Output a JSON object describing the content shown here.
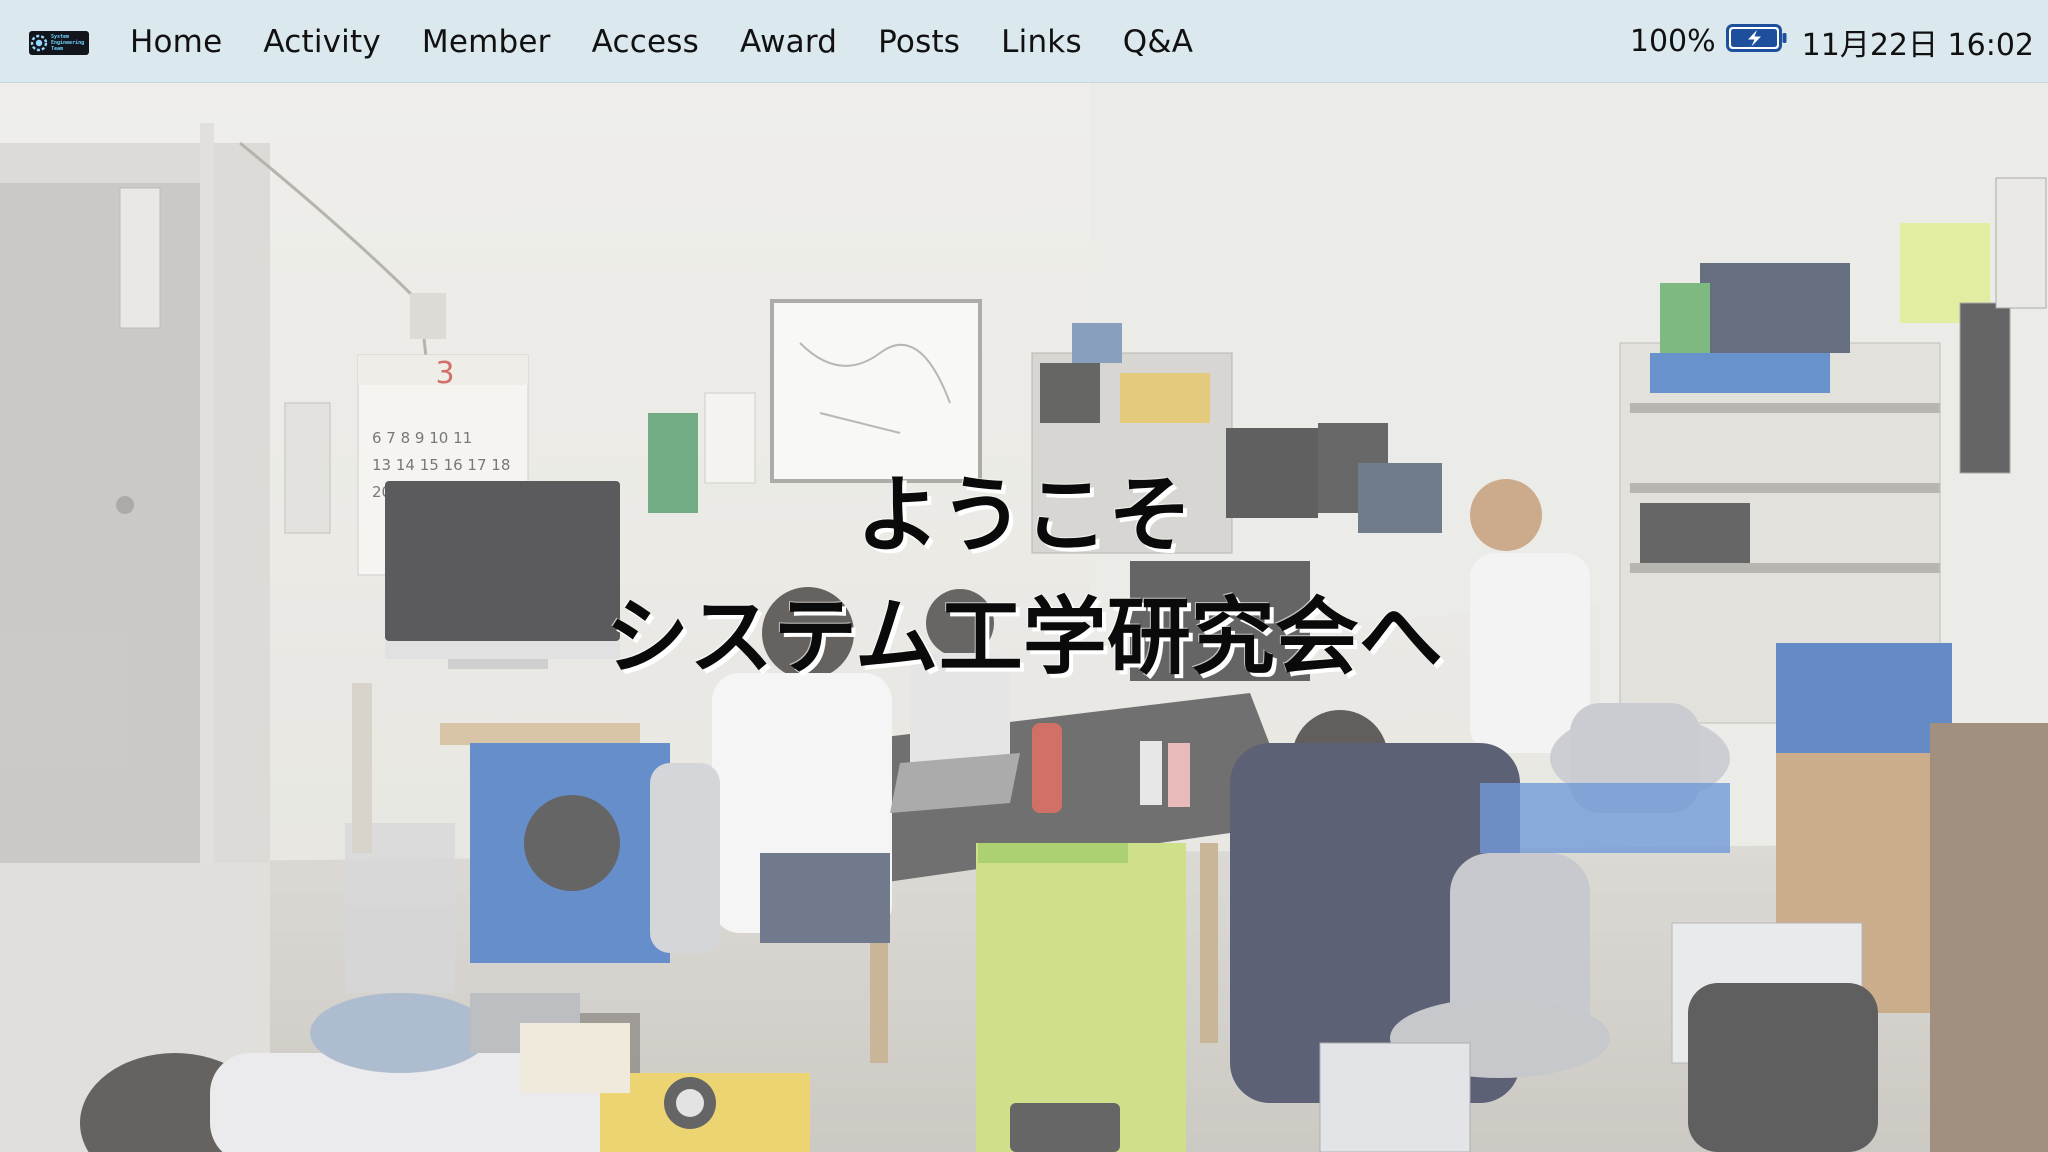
{
  "menubar": {
    "logo": {
      "icon": "gear-logo-icon",
      "text_lines": [
        "System",
        "Engineering",
        "Team"
      ]
    },
    "nav": [
      {
        "label": "Home"
      },
      {
        "label": "Activity"
      },
      {
        "label": "Member"
      },
      {
        "label": "Access"
      },
      {
        "label": "Award"
      },
      {
        "label": "Posts"
      },
      {
        "label": "Links"
      },
      {
        "label": "Q&A"
      }
    ],
    "status": {
      "battery_percent": "100%",
      "battery_icon": "battery-charging-icon",
      "datetime": "11月22日 16:02"
    }
  },
  "hero": {
    "line1": "ようこそ",
    "line2": "システム工学研究会へ",
    "photo": "lab-room-photo"
  },
  "colors": {
    "menubar_bg": "#dbe8ee",
    "battery_blue": "#1d4f9c",
    "text": "#111111"
  }
}
